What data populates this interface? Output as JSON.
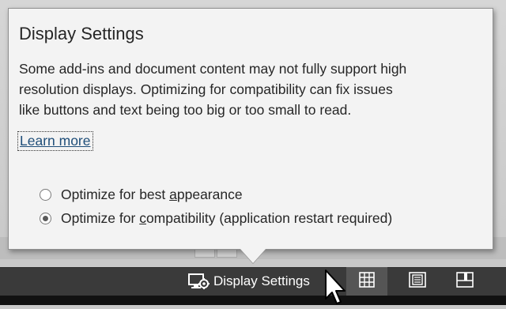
{
  "popup": {
    "title": "Display Settings",
    "body_lines": [
      "Some add-ins and document content may not fully support high",
      "resolution displays.  Optimizing for compatibility can fix issues",
      "like buttons and text being too big or too small to read."
    ],
    "learn_more": "Learn more",
    "options": [
      {
        "pre": "Optimize for best ",
        "key": "a",
        "post": "ppearance",
        "checked": false
      },
      {
        "pre": "Optimize for ",
        "key": "c",
        "post": "ompatibility (application restart required)",
        "checked": true
      }
    ]
  },
  "status_bar": {
    "display_settings_label": "Display Settings",
    "icons": [
      "display-settings-icon",
      "normal-view-icon",
      "page-layout-icon",
      "page-break-preview-icon"
    ]
  },
  "colors": {
    "status_bar_bg": "#3a3a3a",
    "popup_bg": "#f3f3f3",
    "link": "#1f4e79"
  }
}
